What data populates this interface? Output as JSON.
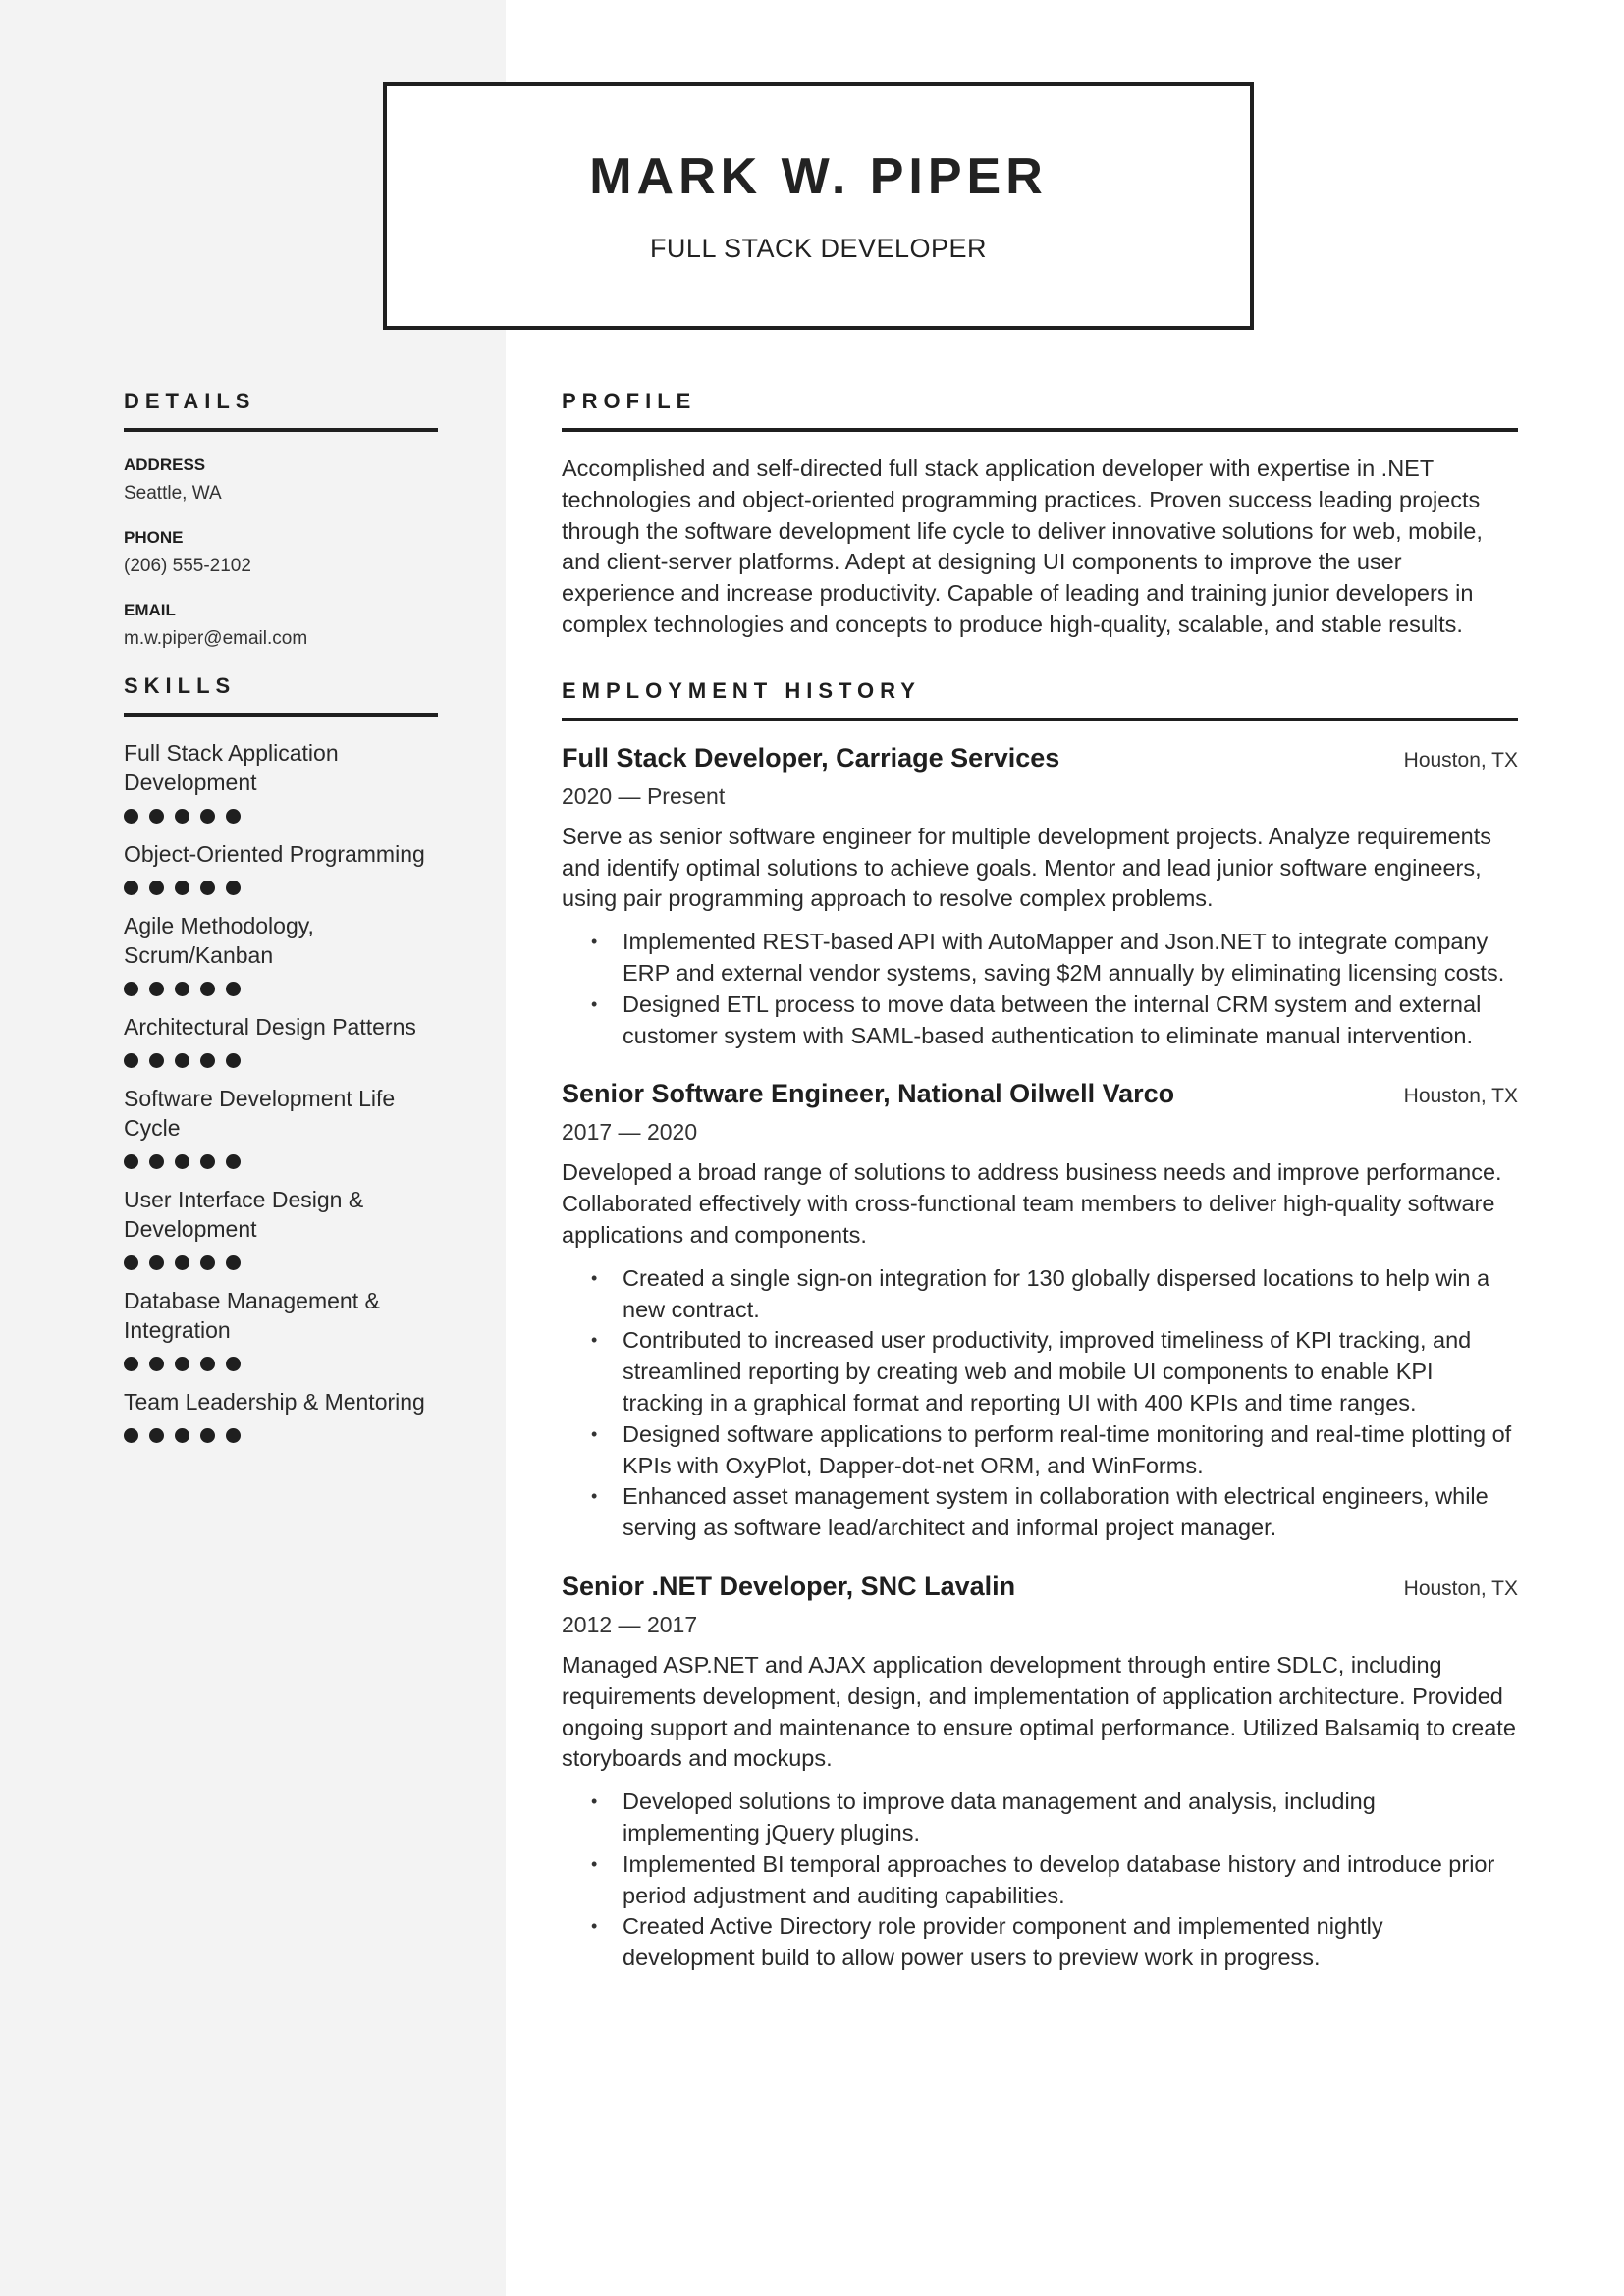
{
  "header": {
    "name": "MARK W. PIPER",
    "title": "FULL STACK DEVELOPER"
  },
  "details": {
    "heading": "DETAILS",
    "address_label": "ADDRESS",
    "address": "Seattle, WA",
    "phone_label": "PHONE",
    "phone": "(206) 555-2102",
    "email_label": "EMAIL",
    "email": "m.w.piper@email.com"
  },
  "skills": {
    "heading": "SKILLS",
    "max_level": 5,
    "items": [
      {
        "name": "Full Stack Application Development",
        "level": 5
      },
      {
        "name": "Object-Oriented Programming",
        "level": 5
      },
      {
        "name": "Agile Methodology, Scrum/Kanban",
        "level": 5
      },
      {
        "name": "Architectural Design Patterns",
        "level": 5
      },
      {
        "name": "Software Development Life Cycle",
        "level": 5
      },
      {
        "name": "User Interface Design & Development",
        "level": 5
      },
      {
        "name": "Database Management & Integration",
        "level": 5
      },
      {
        "name": "Team Leadership & Mentoring",
        "level": 5
      }
    ]
  },
  "profile": {
    "heading": "PROFILE",
    "text": "Accomplished and self-directed full stack application developer with expertise in .NET technologies and object-oriented programming practices. Proven success leading projects through the software development life cycle to deliver innovative solutions for web, mobile, and client-server platforms. Adept at designing UI components to improve the user experience and increase productivity. Capable of leading and training junior developers in complex technologies and concepts to produce high-quality, scalable, and stable results."
  },
  "employment": {
    "heading": "EMPLOYMENT HISTORY",
    "jobs": [
      {
        "title": "Full Stack Developer, Carriage Services",
        "location": "Houston, TX",
        "dates": "2020 — Present",
        "description": "Serve as senior software engineer for multiple development projects. Analyze requirements and identify optimal solutions to achieve goals. Mentor and lead junior software engineers, using pair programming approach to resolve complex problems.",
        "bullets": [
          "Implemented REST-based API with AutoMapper and Json.NET to integrate company ERP and external vendor systems, saving $2M annually by eliminating licensing costs.",
          "Designed ETL process to move data between the internal CRM system and external customer system with SAML-based authentication to eliminate manual intervention."
        ]
      },
      {
        "title": "Senior Software Engineer, National Oilwell Varco",
        "location": "Houston, TX",
        "dates": "2017 — 2020",
        "description": "Developed a broad range of solutions to address business needs and improve performance. Collaborated effectively with cross-functional team members to deliver high-quality software applications and components.",
        "bullets": [
          "Created a single sign-on integration for 130 globally dispersed locations to help win a new contract.",
          "Contributed to increased user productivity, improved timeliness of KPI tracking, and streamlined reporting by creating web and mobile UI components to enable KPI tracking in a graphical format and reporting UI with 400 KPIs and time ranges.",
          "Designed software applications to perform real-time monitoring and real-time plotting of KPIs with OxyPlot, Dapper-dot-net ORM, and WinForms.",
          "Enhanced asset management system in collaboration with electrical engineers, while serving as software lead/architect and informal project manager."
        ]
      },
      {
        "title": "Senior .NET Developer, SNC Lavalin",
        "location": "Houston, TX",
        "dates": "2012 — 2017",
        "description": "Managed ASP.NET and AJAX application development through entire SDLC, including requirements development, design, and implementation of application architecture. Provided ongoing support and maintenance to ensure optimal performance. Utilized Balsamiq to create storyboards and mockups.",
        "bullets": [
          "Developed solutions to improve data management and analysis, including implementing jQuery plugins.",
          "Implemented BI temporal approaches to develop database history and introduce prior period adjustment and auditing capabilities.",
          "Created Active Directory role provider component and implemented nightly development build to allow power users to preview work in progress."
        ]
      }
    ]
  },
  "icons": {
    "bullet": "•"
  },
  "colors": {
    "sidebar_bg": "#f3f3f3",
    "text": "#1f1f1f",
    "skill_dot": "#1f1f1f"
  }
}
